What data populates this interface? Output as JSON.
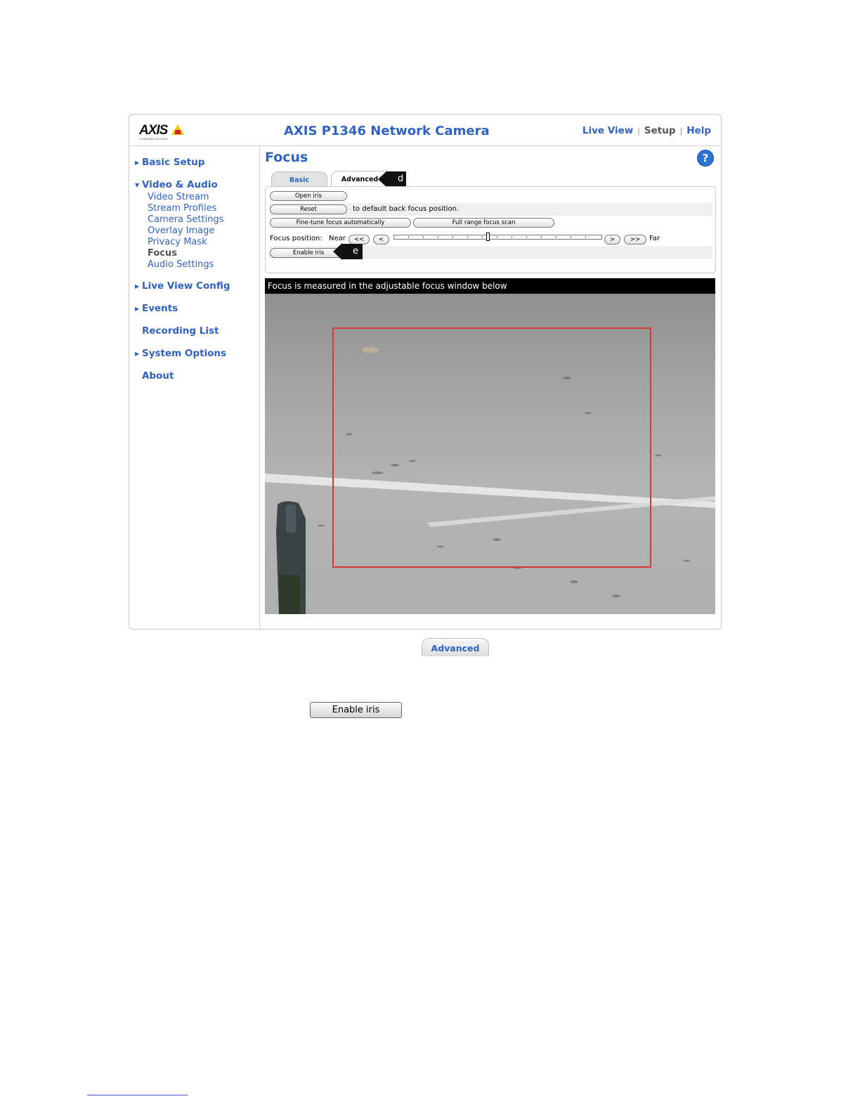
{
  "header": {
    "logo_text": "AXIS",
    "logo_sub": "COMMUNICATIONS",
    "title": "AXIS P1346 Network Camera",
    "nav": {
      "live_view": "Live View",
      "setup": "Setup",
      "help": "Help",
      "separator": "|"
    }
  },
  "sidebar": {
    "basic_setup": "Basic Setup",
    "video_audio": "Video & Audio",
    "video_audio_items": [
      "Video Stream",
      "Stream Profiles",
      "Camera Settings",
      "Overlay Image",
      "Privacy Mask",
      "Focus",
      "Audio Settings"
    ],
    "live_view_config": "Live View Config",
    "events": "Events",
    "recording_list": "Recording List",
    "system_options": "System Options",
    "about": "About"
  },
  "main": {
    "title": "Focus",
    "help_icon": "?",
    "tabs": {
      "basic": "Basic",
      "advanced": "Advanced"
    },
    "buttons": {
      "open_iris": "Open iris",
      "reset": "Reset",
      "reset_suffix": "to default back focus position.",
      "fine_tune": "Fine-tune focus automatically",
      "full_range": "Full range focus scan",
      "enable_iris": "Enable iris",
      "step_far_back": "<<",
      "step_back": "<",
      "step_forward": ">",
      "step_far_forward": ">>"
    },
    "focus_position_label": "Focus position:",
    "near_label": "Near",
    "far_label": "Far",
    "focus_slider_position": 0.45,
    "callouts": {
      "d": "d",
      "e": "e"
    },
    "view_caption": "Focus is measured in the adjustable focus window below"
  },
  "below": {
    "advanced_tab": "Advanced",
    "enable_iris_button": "Enable iris"
  },
  "colors": {
    "link_blue": "#2f63c3",
    "focus_window": "#d33b3b"
  }
}
